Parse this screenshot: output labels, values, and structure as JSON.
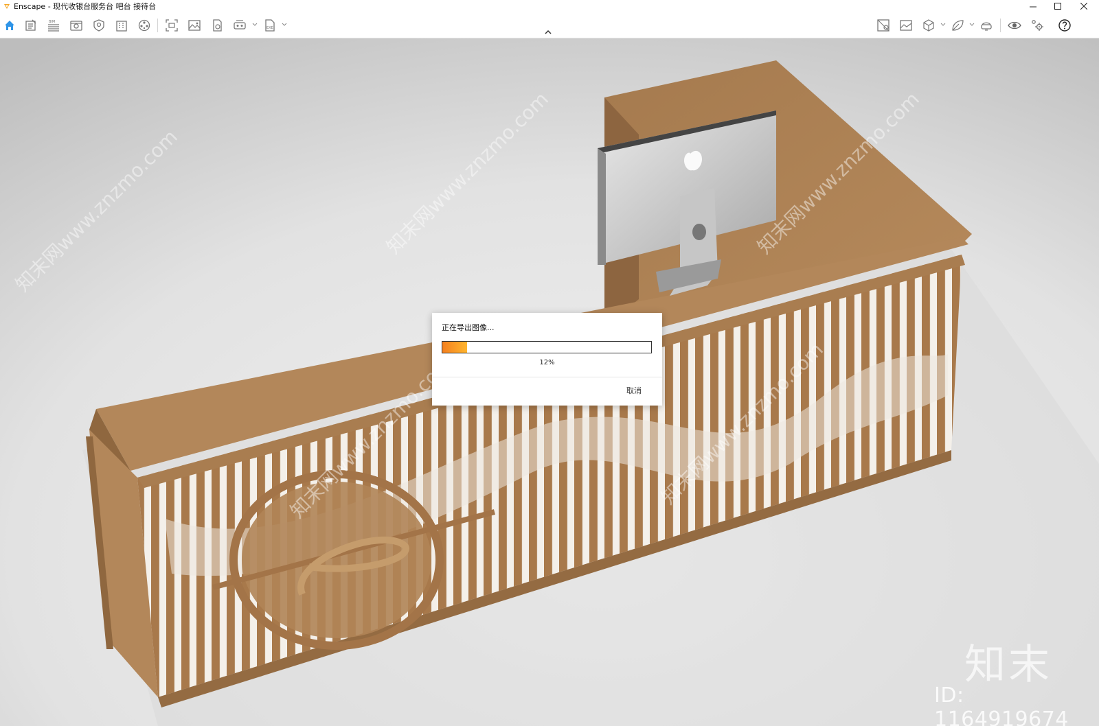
{
  "window": {
    "app_name": "Enscape",
    "title": "Enscape - 现代收银台服务台 吧台 接待台",
    "minimize_icon": "minimize-icon",
    "maximize_icon": "maximize-icon",
    "close_icon": "close-icon"
  },
  "toolbar": {
    "left_tools": [
      {
        "name": "home-icon"
      },
      {
        "name": "project-notes-icon"
      },
      {
        "name": "bim-icon",
        "label": "BIM"
      },
      {
        "name": "view-management-icon"
      },
      {
        "name": "asset-library-icon"
      },
      {
        "name": "building-icon"
      },
      {
        "name": "video-editor-icon"
      },
      {
        "name": "screenshot-icon"
      },
      {
        "name": "batch-render-icon"
      },
      {
        "name": "panorama-icon"
      },
      {
        "name": "vr-export-icon"
      },
      {
        "name": "exe-export-icon",
        "label": "EXE"
      }
    ],
    "right_tools": [
      {
        "name": "material-editor-icon"
      },
      {
        "name": "atmosphere-icon"
      },
      {
        "name": "cube-view-icon"
      },
      {
        "name": "leaf-icon"
      },
      {
        "name": "vr-headset-icon"
      },
      {
        "name": "visibility-icon"
      },
      {
        "name": "settings-icon"
      },
      {
        "name": "help-icon"
      }
    ],
    "accent_color": "#2f95e8"
  },
  "viewport": {
    "watermark_id": "ID: 1164919674",
    "watermark_logo": "知末",
    "watermark_repeat": "知末网www.znzmo.com"
  },
  "dialog": {
    "title": "正在导出图像...",
    "progress": 0.12,
    "progress_text": "12%",
    "cancel_label": "取消",
    "progress_color_start": "#f4801f",
    "progress_color_end": "#ffb52e"
  }
}
